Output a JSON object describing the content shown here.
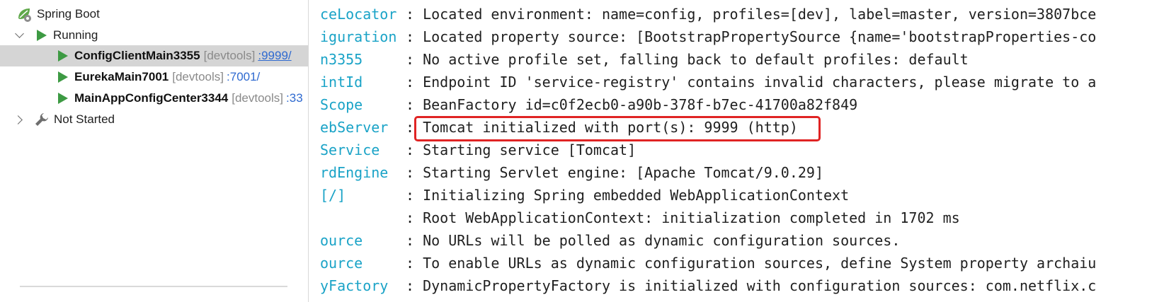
{
  "tree": {
    "root": {
      "label": "Spring Boot",
      "icon": "spring-boot-icon"
    },
    "running": {
      "label": "Running"
    },
    "apps": [
      {
        "name": "ConfigClientMain3355",
        "tag": "[devtools]",
        "port": ":9999/"
      },
      {
        "name": "EurekaMain7001",
        "tag": "[devtools]",
        "port": ":7001/"
      },
      {
        "name": "MainAppConfigCenter3344",
        "tag": "[devtools]",
        "port": ":33"
      }
    ],
    "not_started": {
      "label": "Not Started",
      "icon": "wrench-icon"
    }
  },
  "console": {
    "lines": [
      {
        "logger": "ceLocator",
        "msg": ": Located environment: name=config, profiles=[dev], label=master, version=3807bce"
      },
      {
        "logger": "iguration",
        "msg": ": Located property source: [BootstrapPropertySource {name='bootstrapProperties-co"
      },
      {
        "logger": "n3355",
        "msg": ": No active profile set, falling back to default profiles: default"
      },
      {
        "logger": "intId",
        "msg": ": Endpoint ID 'service-registry' contains invalid characters, please migrate to a"
      },
      {
        "logger": "Scope",
        "msg": ": BeanFactory id=c0f2ecb0-a90b-378f-b7ec-41700a82f849"
      },
      {
        "logger": "ebServer",
        "msg": ": Tomcat initialized with port(s): 9999 (http)"
      },
      {
        "logger": "Service",
        "msg": ": Starting service [Tomcat]"
      },
      {
        "logger": "rdEngine",
        "msg": ": Starting Servlet engine: [Apache Tomcat/9.0.29]"
      },
      {
        "logger": "[/]",
        "msg": ": Initializing Spring embedded WebApplicationContext"
      },
      {
        "logger": "",
        "msg": ": Root WebApplicationContext: initialization completed in 1702 ms"
      },
      {
        "logger": "ource",
        "msg": ": No URLs will be polled as dynamic configuration sources."
      },
      {
        "logger": "ource",
        "msg": ": To enable URLs as dynamic configuration sources, define System property archaiu"
      },
      {
        "logger": "yFactory",
        "msg": ": DynamicPropertyFactory is initialized with configuration sources: com.netflix.c"
      }
    ]
  },
  "colors": {
    "logger": "#1aa3c7",
    "run_icon": "#3d9a43",
    "highlight_box": "#e02424",
    "selected_row": "#d5d5d5"
  }
}
